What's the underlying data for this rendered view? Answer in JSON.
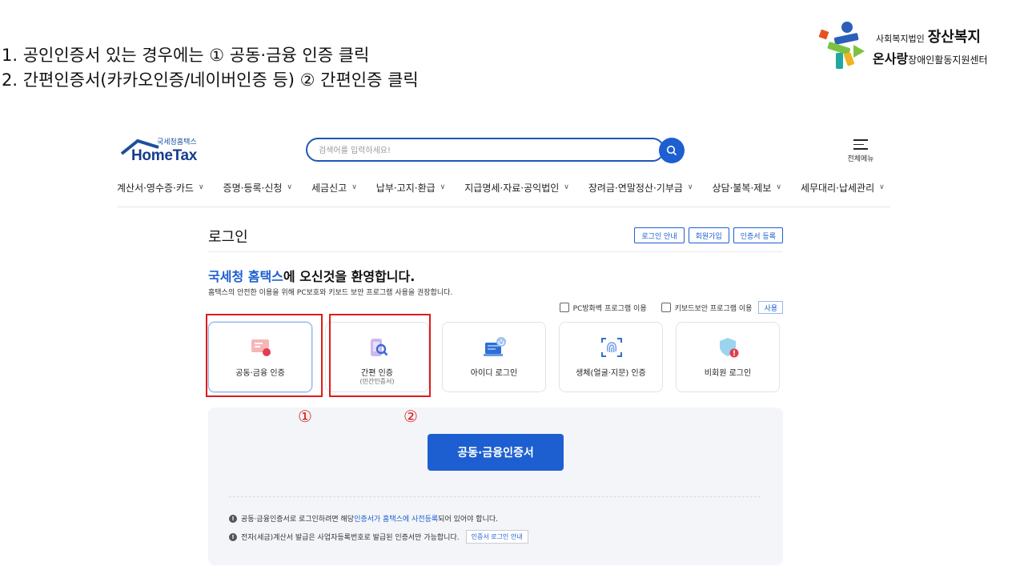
{
  "instructions": [
    "1.  공인인증서 있는 경우에는 ① 공동·금융 인증 클릭",
    "2.  간편인증서(카카오인증/네이버인증 등) ② 간편인증 클릭"
  ],
  "org_logo": {
    "line1_small": "사회복지법인",
    "line1_big": "장산복지",
    "line2_big": "온사랑",
    "line2_small": "장애인활동지원센터"
  },
  "hometax": {
    "logo_small": "국세청홈택스",
    "logo_big": "HomeTax",
    "search_placeholder": "검색어를 입력하세요!",
    "menu_label": "전체메뉴",
    "nav": [
      "계산서·영수증·카드",
      "증명·등록·신청",
      "세금신고",
      "납부·고지·환급",
      "지급명세·자료·공익법인",
      "장려금·연말정산·기부금",
      "상담·불복·제보",
      "세무대리·납세관리"
    ],
    "login_title": "로그인",
    "login_links": [
      "로그인 안내",
      "회원가입",
      "인증서 등록"
    ],
    "welcome_highlight": "국세청 홈택스",
    "welcome_rest": "에 오신것을 환영합니다.",
    "welcome_sub": "홈택스의 안전한 이용을 위해 PC보호와 키보드 보안 프로그램 사용을 권장합니다.",
    "option_pc": "PC방화벽 프로그램 이용",
    "option_keyboard": "키보드보안 프로그램 이용",
    "option_use": "사용",
    "cards": [
      {
        "label": "공동·금융 인증",
        "sub": ""
      },
      {
        "label": "간편 인증",
        "sub": "(민간인증서)"
      },
      {
        "label": "아이디 로그인",
        "sub": ""
      },
      {
        "label": "생체(얼굴·지문) 인증",
        "sub": ""
      },
      {
        "label": "비회원 로그인",
        "sub": ""
      }
    ],
    "panel_button": "공동·금융인증서",
    "note1_pre": "공동·금융인증서로 로그인하려면 해당 ",
    "note1_blue": "인증서가 홈택스에 사전등록",
    "note1_post": "되어 있어야 합니다.",
    "note2": "전자(세금)계산서 발급은 사업자등록번호로 발급된 인증서만 가능합니다.",
    "note2_tag": "인증서 로그인 안내",
    "accent_color": "#1d5fd0"
  },
  "annotations": {
    "marker1": "①",
    "marker2": "②",
    "color": "#e01b1b"
  }
}
